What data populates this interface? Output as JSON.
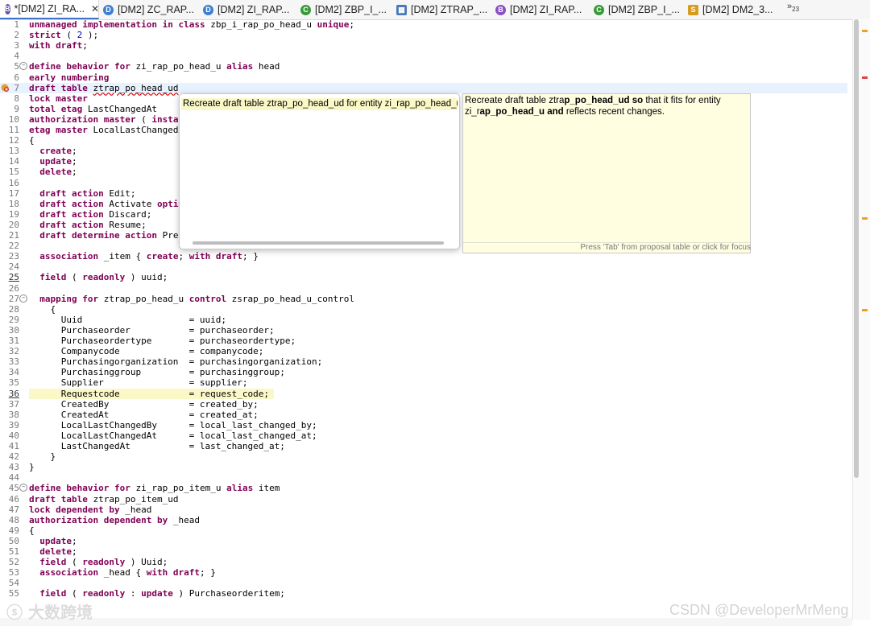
{
  "tabs": [
    {
      "label": "*[DM2] ZI_RA...",
      "icon": "behavior-definition-icon",
      "color": "#6a4fb3",
      "glyph": "B",
      "active": true
    },
    {
      "label": "[DM2] ZC_RAP...",
      "icon": "data-definition-icon",
      "color": "#3f7fcf",
      "glyph": "D",
      "active": false
    },
    {
      "label": "[DM2] ZI_RAP...",
      "icon": "data-definition-icon",
      "color": "#3f7fcf",
      "glyph": "D",
      "active": false
    },
    {
      "label": "[DM2] ZBP_I_...",
      "icon": "class-icon",
      "color": "#3a9a3a",
      "glyph": "C",
      "active": false
    },
    {
      "label": "[DM2] ZTRAP_...",
      "icon": "table-icon",
      "color": "#4a78b8",
      "glyph": "▦",
      "active": false
    },
    {
      "label": "[DM2] ZI_RAP...",
      "icon": "behavior-definition-icon",
      "color": "#8a4fc3",
      "glyph": "B",
      "active": false
    },
    {
      "label": "[DM2] ZBP_I_...",
      "icon": "class-icon",
      "color": "#3a9a3a",
      "glyph": "C",
      "active": false
    },
    {
      "label": "[DM2] DM2_3...",
      "icon": "service-binding-icon",
      "color": "#d89a20",
      "glyph": "S",
      "active": false
    }
  ],
  "overflow_tabs": "»",
  "overflow_count": "23",
  "code_lines": [
    {
      "n": "1",
      "t": "unmanaged implementation in class zbp_i_rap_po_head_u unique;"
    },
    {
      "n": "2",
      "t": "strict ( 2 );"
    },
    {
      "n": "3",
      "t": "with draft;"
    },
    {
      "n": "4",
      "t": ""
    },
    {
      "n": "5",
      "t": "define behavior for zi_rap_po_head_u alias head",
      "fold": true
    },
    {
      "n": "6",
      "t": "early numbering"
    },
    {
      "n": "7",
      "t": "draft table ztrap_po_head_ud",
      "error": true,
      "current": true
    },
    {
      "n": "8",
      "t": "lock master"
    },
    {
      "n": "9",
      "t": "total etag LastChangedAt"
    },
    {
      "n": "10",
      "t": "authorization master ( instance )"
    },
    {
      "n": "11",
      "t": "etag master LocalLastChangedAt"
    },
    {
      "n": "12",
      "t": "{"
    },
    {
      "n": "13",
      "t": "  create;"
    },
    {
      "n": "14",
      "t": "  update;"
    },
    {
      "n": "15",
      "t": "  delete;"
    },
    {
      "n": "16",
      "t": ""
    },
    {
      "n": "17",
      "t": "  draft action Edit;"
    },
    {
      "n": "18",
      "t": "  draft action Activate optimized;"
    },
    {
      "n": "19",
      "t": "  draft action Discard;"
    },
    {
      "n": "20",
      "t": "  draft action Resume;"
    },
    {
      "n": "21",
      "t": "  draft determine action Prepare;"
    },
    {
      "n": "22",
      "t": ""
    },
    {
      "n": "23",
      "t": "  association _item { create; with draft; }"
    },
    {
      "n": "24",
      "t": ""
    },
    {
      "n": "25",
      "t": "  field ( readonly ) uuid;",
      "bold_ln": true
    },
    {
      "n": "26",
      "t": ""
    },
    {
      "n": "27",
      "t": "  mapping for ztrap_po_head_u control zsrap_po_head_u_control",
      "fold": true
    },
    {
      "n": "28",
      "t": "    {"
    },
    {
      "n": "29",
      "t": "      Uuid                    = uuid;"
    },
    {
      "n": "30",
      "t": "      Purchaseorder           = purchaseorder;"
    },
    {
      "n": "31",
      "t": "      Purchaseordertype       = purchaseordertype;"
    },
    {
      "n": "32",
      "t": "      Companycode             = companycode;"
    },
    {
      "n": "33",
      "t": "      Purchasingorganization  = purchasingorganization;"
    },
    {
      "n": "34",
      "t": "      Purchasinggroup         = purchasinggroup;"
    },
    {
      "n": "35",
      "t": "      Supplier                = supplier;"
    },
    {
      "n": "36",
      "t": "      Requestcode             = request_code;",
      "bold_ln": true,
      "highlight": true
    },
    {
      "n": "37",
      "t": "      CreatedBy               = created_by;"
    },
    {
      "n": "38",
      "t": "      CreatedAt               = created_at;"
    },
    {
      "n": "39",
      "t": "      LocalLastChangedBy      = local_last_changed_by;"
    },
    {
      "n": "40",
      "t": "      LocalLastChangedAt      = local_last_changed_at;"
    },
    {
      "n": "41",
      "t": "      LastChangedAt           = last_changed_at;"
    },
    {
      "n": "42",
      "t": "    }"
    },
    {
      "n": "43",
      "t": "}"
    },
    {
      "n": "44",
      "t": ""
    },
    {
      "n": "45",
      "t": "define behavior for zi_rap_po_item_u alias item",
      "fold": true
    },
    {
      "n": "46",
      "t": "draft table ztrap_po_item_ud"
    },
    {
      "n": "47",
      "t": "lock dependent by _head"
    },
    {
      "n": "48",
      "t": "authorization dependent by _head"
    },
    {
      "n": "49",
      "t": "{"
    },
    {
      "n": "50",
      "t": "  update;"
    },
    {
      "n": "51",
      "t": "  delete;"
    },
    {
      "n": "52",
      "t": "  field ( readonly ) Uuid;"
    },
    {
      "n": "53",
      "t": "  association _head { with draft; }"
    },
    {
      "n": "54",
      "t": ""
    },
    {
      "n": "55",
      "t": "  field ( readonly : update ) Purchaseorderitem;"
    }
  ],
  "keywords": [
    "unmanaged",
    "implementation",
    "in",
    "class",
    "unique",
    "strict",
    "with",
    "draft",
    "define",
    "behavior",
    "for",
    "alias",
    "early",
    "numbering",
    "table",
    "lock",
    "master",
    "total",
    "etag",
    "authorization",
    "create",
    "update",
    "delete",
    "action",
    "determine",
    "association",
    "field",
    "readonly",
    "mapping",
    "control",
    "dependent",
    "by",
    "instance",
    "optimized"
  ],
  "quick_fix": {
    "proposal": "Recreate draft table ztrap_po_head_ud for entity zi_rap_po_head_u",
    "description_parts": [
      {
        "text": "Recreate draft table ztra",
        "bold": false
      },
      {
        "text": "p_po_head_ud so",
        "bold": true
      },
      {
        "text": " that it fits for entity zi_r",
        "bold": false
      },
      {
        "text": "ap_po_head_u and",
        "bold": true
      },
      {
        "text": " reflects recent changes.",
        "bold": false
      }
    ],
    "footer": "Press 'Tab' from proposal table or click for focus"
  },
  "watermark_left": "大数跨境",
  "watermark_right": "CSDN @DeveloperMrMeng",
  "colors": {
    "keyword": "#7f0055",
    "number": "#0000c0",
    "current_line": "#e8f2fe",
    "highlight": "#fbf8c8",
    "info_bg": "#fffee1"
  }
}
